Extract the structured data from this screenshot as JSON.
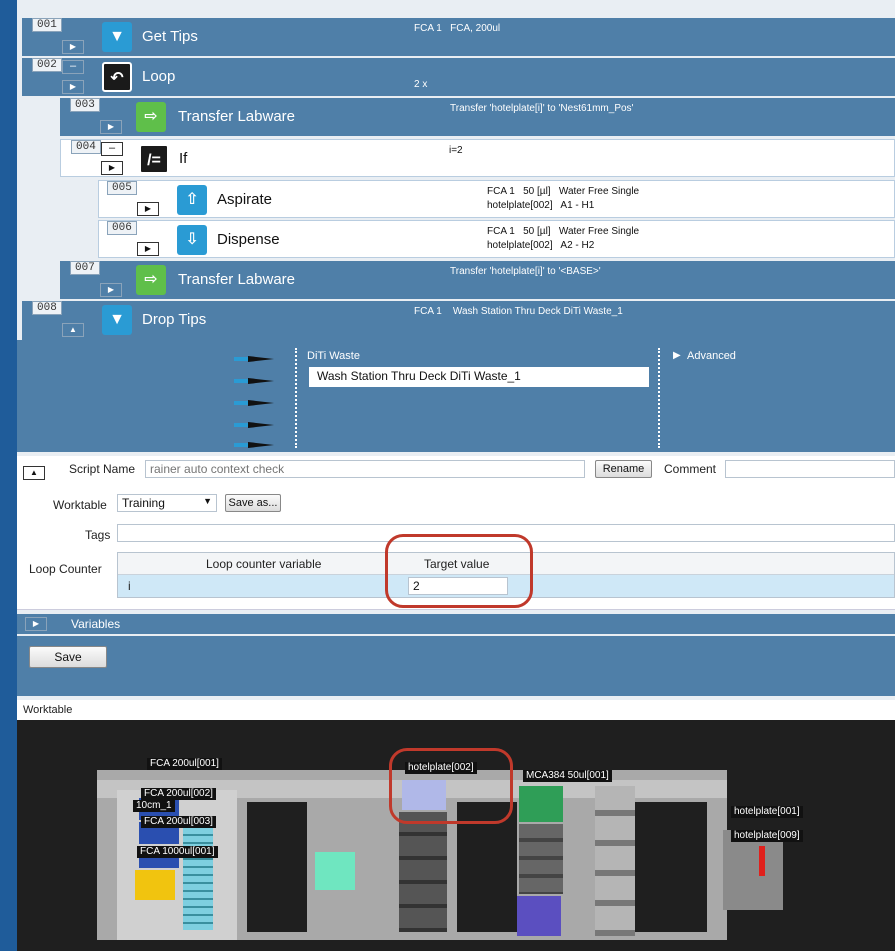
{
  "steps": [
    {
      "num": "001",
      "title": "Get Tips",
      "detail": "FCA 1   FCA, 200ul",
      "icon": "get-tips-icon"
    },
    {
      "num": "002",
      "title": "Loop",
      "detail": "2 x",
      "icon": "loop-icon"
    },
    {
      "num": "003",
      "title": "Transfer Labware",
      "detail": "Transfer 'hotelplate[i]' to 'Nest61mm_Pos'",
      "icon": "transfer-labware-icon"
    },
    {
      "num": "004",
      "title": "If",
      "detail": "i=2",
      "icon": "if-icon"
    },
    {
      "num": "005",
      "title": "Aspirate",
      "detail": "FCA 1   50 [µl]   Water Free Single\nhotelplate[002]   A1 - H1",
      "icon": "aspirate-icon"
    },
    {
      "num": "006",
      "title": "Dispense",
      "detail": "FCA 1   50 [µl]   Water Free Single\nhotelplate[002]   A2 - H2",
      "icon": "dispense-icon"
    },
    {
      "num": "007",
      "title": "Transfer Labware",
      "detail": "Transfer 'hotelplate[i]' to '<BASE>'",
      "icon": "transfer-labware-icon"
    },
    {
      "num": "008",
      "title": "Drop Tips",
      "detail": "FCA 1    Wash Station Thru Deck DiTi Waste_1",
      "icon": "drop-tips-icon"
    }
  ],
  "drop_tips": {
    "diti_label": "DiTi Waste",
    "diti_value": "Wash Station Thru Deck DiTi Waste_1",
    "advanced_label": "Advanced"
  },
  "script": {
    "name_label": "Script Name",
    "name_placeholder": "rainer auto context check",
    "rename_button": "Rename",
    "comment_label": "Comment",
    "worktable_label": "Worktable",
    "worktable_value": "Training",
    "saveas_button": "Save as...",
    "tags_label": "Tags",
    "loop_counter_label": "Loop Counter",
    "col_variable": "Loop counter variable",
    "col_target": "Target value",
    "row_variable": "i",
    "row_target": "2",
    "variables_label": "Variables",
    "save_button": "Save"
  },
  "worktable": {
    "title": "Worktable",
    "labels": {
      "fca200_001": "FCA 200ul[001]",
      "fca200_002": "FCA 200ul[002]",
      "fca200_003": "FCA 200ul[003]",
      "fca1000_001": "FCA 1000ul[001]",
      "small": "10cm_1",
      "hotelplate_002": "hotelplate[002]",
      "mca384": "MCA384 50ul[001]",
      "hotelplate_001": "hotelplate[001]",
      "hotelplate_009": "hotelplate[009]"
    }
  },
  "colors": {
    "row_blue": "#4f7fa8",
    "border_blue": "#1f5c9a",
    "highlight_red": "#c0392b"
  }
}
